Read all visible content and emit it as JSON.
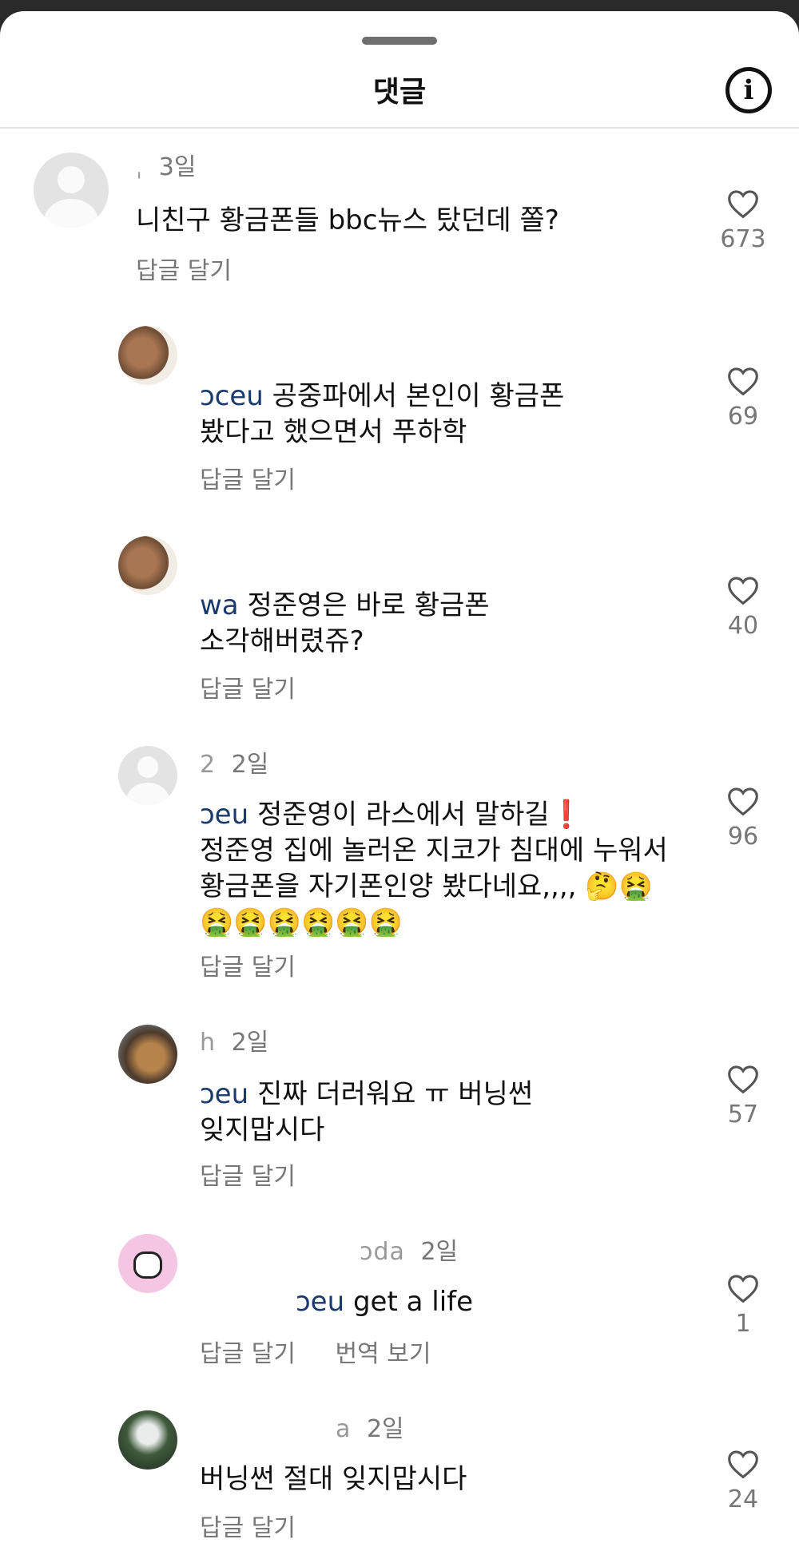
{
  "header": {
    "title": "댓글",
    "info_icon": "info-icon"
  },
  "comments": [
    {
      "avatar": "default",
      "name": "ˌ",
      "date": "3일",
      "mention": "",
      "text": "니친구 황금폰들 bbc뉴스 탔던데 쫄?",
      "reply": "답글 달기",
      "translate": "",
      "likes": "673"
    },
    {
      "avatar": "photo-cat",
      "name": "",
      "date": "",
      "mention": "ɔceu",
      "text": "공중파에서 본인이 황금폰\n봤다고 했으면서 푸하학",
      "reply": "답글 달기",
      "translate": "",
      "likes": "69"
    },
    {
      "avatar": "photo-cat",
      "name": "",
      "date": "",
      "mention": "wa",
      "text": "정준영은 바로 황금폰\n소각해버렸쥬?",
      "reply": "답글 달기",
      "translate": "",
      "likes": "40"
    },
    {
      "avatar": "default",
      "name": "2",
      "date": "2일",
      "mention": "ɔeu",
      "text": "정준영이 라스에서 말하길❗\n정준영 집에 놀러온 지코가 침대에 누워서\n황금폰을 자기폰인양 봤다네요,,,, 🤔🤮\n🤮🤮🤮🤮🤮🤮",
      "reply": "답글 달기",
      "translate": "",
      "likes": "96"
    },
    {
      "avatar": "photo-dog",
      "name": "h",
      "date": "2일",
      "mention": "ɔeu",
      "text": "진짜 더러워요 ㅠ 버닝썬\n잊지맙시다",
      "reply": "답글 달기",
      "translate": "",
      "likes": "57"
    },
    {
      "avatar": "photo-pink",
      "name": "ɔda",
      "date": "2일",
      "mention": "ɔeu",
      "text": "get a life",
      "reply": "답글 달기",
      "translate": "번역 보기",
      "likes": "1"
    },
    {
      "avatar": "photo-green",
      "name": "a",
      "date": "2일",
      "mention": "",
      "text": "버닝썬 절대 잊지맙시다",
      "reply": "답글 달기",
      "translate": "",
      "likes": "24"
    }
  ]
}
